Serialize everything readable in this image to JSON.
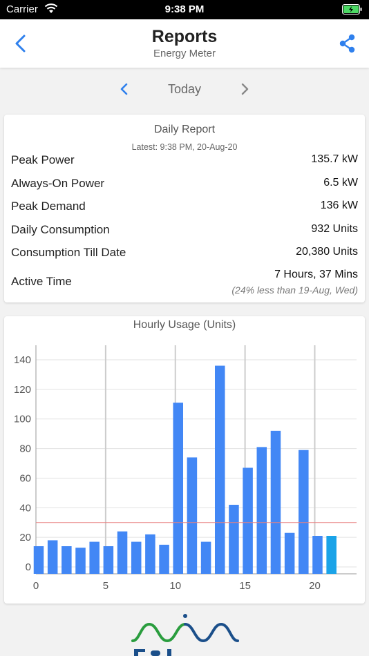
{
  "status_bar": {
    "carrier": "Carrier",
    "time": "9:38 PM",
    "battery_color": "#4cd964"
  },
  "navbar": {
    "title": "Reports",
    "subtitle": "Energy Meter",
    "accent_color": "#2f80ed",
    "back_icon": "chevron-left-icon",
    "share_icon": "share-icon"
  },
  "date_nav": {
    "label": "Today",
    "prev_icon": "chevron-left-icon",
    "next_icon": "chevron-right-icon"
  },
  "daily_report": {
    "title": "Daily Report",
    "latest": "Latest: 9:38 PM, 20-Aug-20",
    "rows": [
      {
        "label": "Peak Power",
        "value": "135.7 kW"
      },
      {
        "label": "Always-On Power",
        "value": "6.5 kW"
      },
      {
        "label": "Peak Demand",
        "value": "136 kW"
      },
      {
        "label": "Daily Consumption",
        "value": "932 Units"
      },
      {
        "label": "Consumption Till Date",
        "value": "20,380 Units"
      },
      {
        "label": "Active Time",
        "value": "7 Hours, 37 Mins",
        "note": "(24% less than 19-Aug, Wed)"
      }
    ]
  },
  "chart_data": {
    "type": "bar",
    "title": "Hourly Usage (Units)",
    "xlabel": "",
    "ylabel": "",
    "x": [
      0,
      1,
      2,
      3,
      4,
      5,
      6,
      7,
      8,
      9,
      10,
      11,
      12,
      13,
      14,
      15,
      16,
      17,
      18,
      19,
      20,
      21
    ],
    "values": [
      14,
      18,
      14,
      13,
      17,
      14,
      24,
      17,
      22,
      15,
      111,
      74,
      17,
      136,
      42,
      67,
      81,
      92,
      23,
      79,
      21,
      21
    ],
    "highlight_index": 21,
    "bar_color": "#4287f5",
    "highlight_color": "#1aa3e8",
    "threshold": 30,
    "threshold_color": "#e88080",
    "yticks": [
      0,
      20,
      40,
      60,
      80,
      100,
      120,
      140
    ],
    "xticks": [
      0,
      5,
      10,
      15,
      20
    ],
    "xlim": [
      0,
      23
    ],
    "ylim": [
      0,
      140
    ],
    "grid": true
  },
  "logo": {
    "name": "brand-logo",
    "colors": [
      "#2a9d3e",
      "#1b4f8a"
    ]
  }
}
